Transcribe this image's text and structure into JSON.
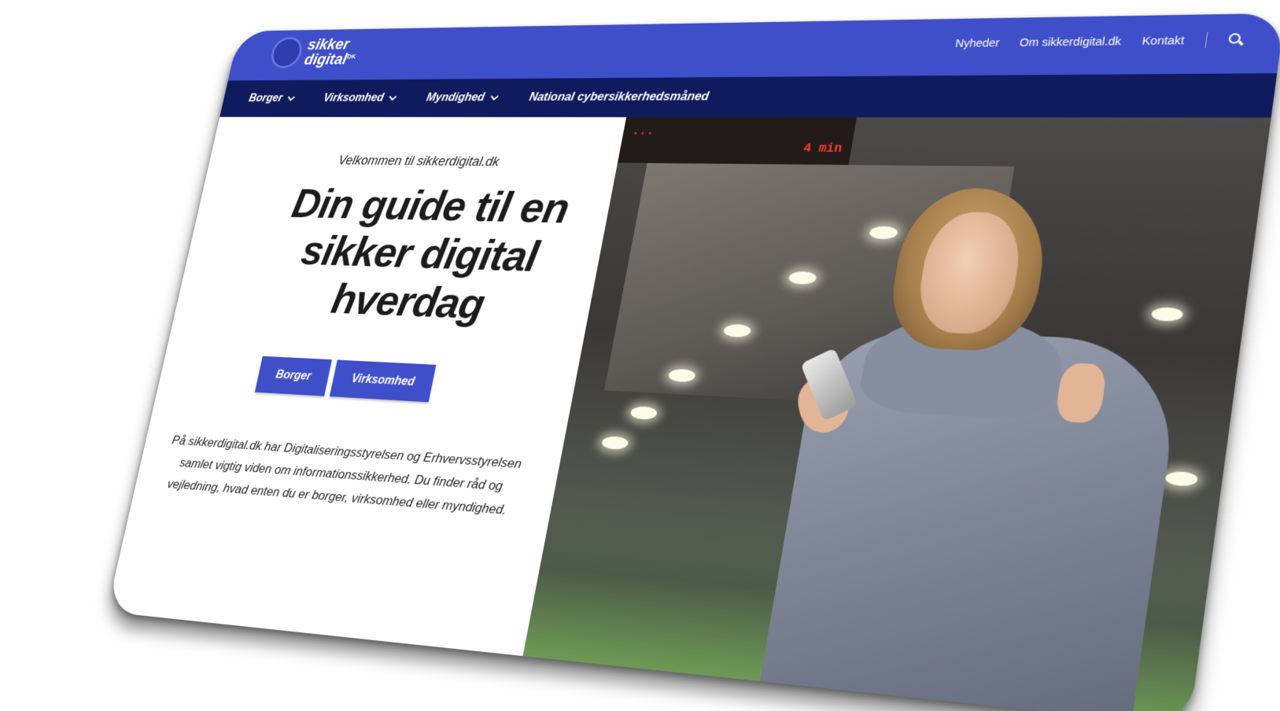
{
  "logo": {
    "line1": "sikker",
    "line2": "digital",
    "suffix": "DK"
  },
  "topnav": {
    "links": [
      "Nyheder",
      "Om sikkerdigital.dk",
      "Kontakt"
    ],
    "search_icon": "search-icon"
  },
  "mainnav": {
    "items": [
      {
        "label": "Borger",
        "has_dropdown": true
      },
      {
        "label": "Virksomhed",
        "has_dropdown": true
      },
      {
        "label": "Myndighed",
        "has_dropdown": true
      },
      {
        "label": "National cybersikkerhedsmåned",
        "has_dropdown": false
      }
    ]
  },
  "hero": {
    "welcome": "Velkommen til sikkerdigital.dk",
    "headline": "Din guide til en sikker digital hverdag",
    "buttons": [
      "Borger",
      "Virksomhed"
    ],
    "intro": "På sikkerdigital.dk har Digitaliseringsstyrelsen og Erhvervsstyrelsen samlet vigtig viden om informationssikkerhed. Du finder råd og vejledning, hvad enten du er borger, virksomhed eller myndighed."
  },
  "photo": {
    "ticker_line1": "...",
    "ticker_line2": "4 min"
  },
  "colors": {
    "topbar": "#3f4fca",
    "navbar": "#101b5e",
    "button": "#3f4fca",
    "text": "#1c1c1c"
  }
}
